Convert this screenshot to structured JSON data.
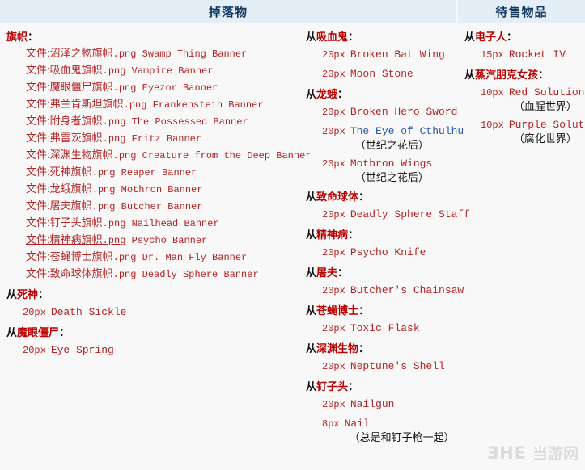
{
  "header": {
    "drops_title": "掉落物",
    "sale_title": "待售物品"
  },
  "left_column": {
    "banner_group": {
      "label": "旗帜",
      "colon": "：",
      "files": [
        {
          "prefix": "文件:沼泽之物旗帜",
          "ext": ".png",
          "tail": " Swamp Thing Banner",
          "hover": false
        },
        {
          "prefix": "文件:吸血鬼旗帜",
          "ext": ".png",
          "tail": " Vampire Banner",
          "hover": false
        },
        {
          "prefix": "文件:魔眼僵尸旗帜",
          "ext": ".png",
          "tail": " Eyezor Banner",
          "hover": false
        },
        {
          "prefix": "文件:弗兰肯斯坦旗帜",
          "ext": ".png",
          "tail": " Frankenstein Banner",
          "hover": false
        },
        {
          "prefix": "文件:附身者旗帜",
          "ext": ".png",
          "tail": " The Possessed Banner",
          "hover": false
        },
        {
          "prefix": "文件:弗雷茨旗帜",
          "ext": ".png",
          "tail": " Fritz Banner",
          "hover": false
        },
        {
          "prefix": "文件:深渊生物旗帜",
          "ext": ".png",
          "tail": " Creature from the Deep Banner",
          "hover": false
        },
        {
          "prefix": "文件:死神旗帜",
          "ext": ".png",
          "tail": " Reaper Banner",
          "hover": false
        },
        {
          "prefix": "文件:龙蛾旗帜",
          "ext": ".png",
          "tail": " Mothron Banner",
          "hover": false
        },
        {
          "prefix": "文件:屠夫旗帜",
          "ext": ".png",
          "tail": " Butcher Banner",
          "hover": false
        },
        {
          "prefix": "文件:钉子头旗帜",
          "ext": ".png",
          "tail": " Nailhead Banner",
          "hover": false
        },
        {
          "prefix": "文件:精神病旗帜",
          "ext": ".png",
          "tail": " Psycho Banner",
          "hover": true
        },
        {
          "prefix": "文件:苍蝇博士旗帜",
          "ext": ".png",
          "tail": " Dr. Man Fly Banner",
          "hover": false
        },
        {
          "prefix": "文件:致命球体旗帜",
          "ext": ".png",
          "tail": " Deadly Sphere Banner",
          "hover": false
        }
      ]
    },
    "groups": [
      {
        "from": "从",
        "name": "死神",
        "colon": "：",
        "items": [
          {
            "px": "20px",
            "name": "Death Sickle",
            "color": "red",
            "note": ""
          }
        ]
      },
      {
        "from": "从",
        "name": "魔眼僵尸",
        "colon": "：",
        "items": [
          {
            "px": "20px",
            "name": "Eye Spring",
            "color": "red",
            "note": ""
          }
        ]
      }
    ]
  },
  "mid_column": {
    "groups": [
      {
        "from": "从",
        "name": "吸血鬼",
        "colon": "：",
        "items": [
          {
            "px": "20px",
            "name": "Broken Bat Wing",
            "color": "red",
            "note": ""
          },
          {
            "px": "20px",
            "name": "Moon Stone",
            "color": "red",
            "note": ""
          }
        ]
      },
      {
        "from": "从",
        "name": "龙蛾",
        "colon": "：",
        "items": [
          {
            "px": "20px",
            "name": "Broken Hero Sword",
            "color": "red",
            "note": ""
          },
          {
            "px": "20px",
            "name": "The Eye of Cthulhu",
            "color": "blue",
            "note": "（世纪之花后）"
          },
          {
            "px": "20px",
            "name": "Mothron Wings",
            "color": "red",
            "note": "（世纪之花后）"
          }
        ]
      },
      {
        "from": "从",
        "name": "致命球体",
        "colon": "：",
        "items": [
          {
            "px": "20px",
            "name": "Deadly Sphere Staff",
            "color": "red",
            "note": ""
          }
        ]
      },
      {
        "from": "从",
        "name": "精神病",
        "colon": "：",
        "items": [
          {
            "px": "20px",
            "name": "Psycho Knife",
            "color": "red",
            "note": ""
          }
        ]
      },
      {
        "from": "从",
        "name": "屠夫",
        "colon": "：",
        "items": [
          {
            "px": "20px",
            "name": "Butcher's Chainsaw",
            "color": "red",
            "note": ""
          }
        ]
      },
      {
        "from": "从",
        "name": "苍蝇博士",
        "colon": "：",
        "items": [
          {
            "px": "20px",
            "name": "Toxic Flask",
            "color": "red",
            "note": ""
          }
        ]
      },
      {
        "from": "从",
        "name": "深渊生物",
        "colon": "：",
        "items": [
          {
            "px": "20px",
            "name": "Neptune's Shell",
            "color": "red",
            "note": ""
          }
        ]
      },
      {
        "from": "从",
        "name": "钉子头",
        "colon": "：",
        "items": [
          {
            "px": "20px",
            "name": "Nailgun",
            "color": "red",
            "note": ""
          },
          {
            "px": "8px",
            "name": "Nail",
            "color": "red",
            "note": "（总是和钉子枪一起）"
          }
        ]
      }
    ]
  },
  "right_column": {
    "groups": [
      {
        "from": "从",
        "name": "电子人",
        "colon": "：",
        "items": [
          {
            "px": "15px",
            "name": "Rocket IV",
            "color": "red",
            "note": ""
          }
        ]
      },
      {
        "from": "从",
        "name": "蒸汽朋克女孩",
        "colon": "：",
        "items": [
          {
            "px": "10px",
            "name": "Red Solution",
            "color": "red",
            "note": "（血腥世界）"
          },
          {
            "px": "10px",
            "name": "Purple Solution",
            "color": "red",
            "note": "（腐化世界）"
          }
        ]
      }
    ]
  },
  "watermark": {
    "mark": "ƎHE",
    "cn": "当游网"
  },
  "colors": {
    "header_bg": "#e4eef7",
    "header_text": "#14385f",
    "link_red": "#b32424",
    "link_blue": "#2a5aa8",
    "heading_red": "#b80000",
    "page_bg": "#f8f8f8"
  }
}
